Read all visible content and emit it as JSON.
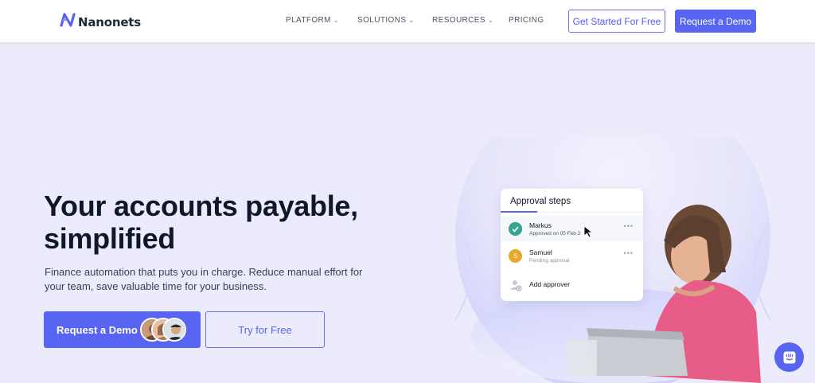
{
  "header": {
    "logo_text": "Nanonets",
    "nav": [
      {
        "label": "PLATFORM",
        "has_dropdown": true
      },
      {
        "label": "SOLUTIONS",
        "has_dropdown": true
      },
      {
        "label": "RESOURCES",
        "has_dropdown": true
      },
      {
        "label": "PRICING",
        "has_dropdown": false
      }
    ],
    "get_started_label": "Get Started For Free",
    "request_demo_label": "Request a Demo"
  },
  "hero": {
    "title_line1": "Your accounts payable,",
    "title_line2": "simplified",
    "subtitle": "Finance automation that puts you in charge. Reduce manual effort for your team, save valuable time for your business.",
    "cta_demo_label": "Request a Demo",
    "cta_free_label": "Try for Free"
  },
  "approval_card": {
    "title": "Approval steps",
    "rows": [
      {
        "name": "Markus",
        "meta": "Approved on 05 Feb 2",
        "status": "approved"
      },
      {
        "name": "Samuel",
        "meta": "Pending approval",
        "status": "pending",
        "initial": "S"
      },
      {
        "name": "Add approver",
        "meta": "",
        "status": "add"
      }
    ]
  },
  "colors": {
    "brand": "#5865f2",
    "background": "#ecebfb",
    "approved": "#3aa58f",
    "pending": "#e6a92a"
  },
  "icons": [
    "nanonets-logo-icon",
    "chevron-down-icon",
    "cursor-icon",
    "chat-icon",
    "more-icon",
    "add-user-icon"
  ]
}
